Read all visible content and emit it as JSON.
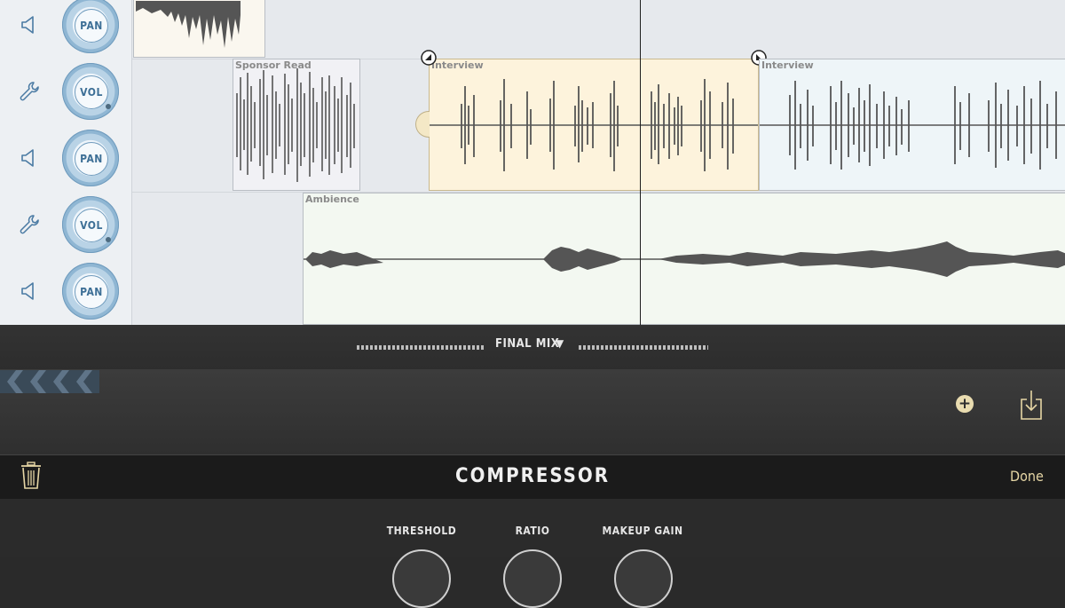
{
  "tracks": [
    {
      "controls": [
        {
          "type": "pan",
          "label": "PAN",
          "icon": "speaker-icon"
        }
      ]
    },
    {
      "controls": [
        {
          "type": "vol",
          "label": "VOL",
          "icon": "wrench-icon"
        },
        {
          "type": "pan",
          "label": "PAN",
          "icon": "speaker-icon"
        }
      ]
    },
    {
      "controls": [
        {
          "type": "vol",
          "label": "VOL",
          "icon": "wrench-icon"
        },
        {
          "type": "pan",
          "label": "PAN",
          "icon": "speaker-icon"
        }
      ]
    }
  ],
  "clips": {
    "sponsor_read": "Sponsor Read",
    "interview_1": "Interview",
    "interview_2": "Interview",
    "ambience": "Ambience"
  },
  "mix": {
    "label": "FINAL MIX",
    "arrow": "▼"
  },
  "fx": {
    "add_label": "+"
  },
  "compressor": {
    "title": "COMPRESSOR",
    "done_label": "Done",
    "params": [
      {
        "label": "THRESHOLD"
      },
      {
        "label": "RATIO"
      },
      {
        "label": "MAKEUP GAIN"
      }
    ]
  },
  "colors": {
    "interview_selected": "#fdf3dc",
    "interview_other": "#eef5f8",
    "ambience": "#f3f8f1",
    "sponsor": "#f1f1f5",
    "knob_accent": "#8fb6d3",
    "done": "#e6d6a5"
  }
}
